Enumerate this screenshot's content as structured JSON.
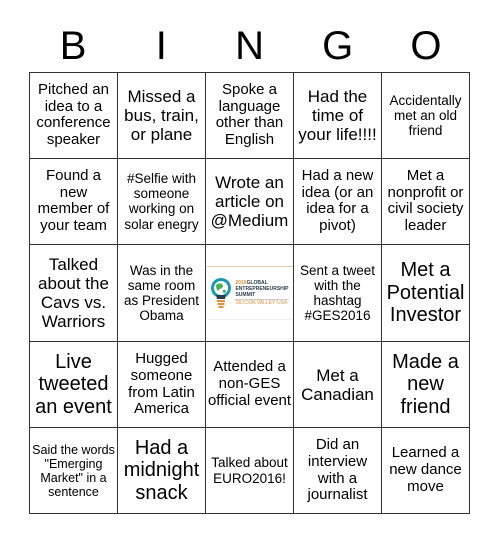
{
  "header": [
    "B",
    "I",
    "N",
    "G",
    "O"
  ],
  "grid": [
    [
      "Pitched an idea to a conference speaker",
      "Missed a bus, train, or plane",
      "Spoke a language other than English",
      "Had the time of your life!!!!",
      "Accidentally met an old friend"
    ],
    [
      "Found a new member of your team",
      "#Selfie with someone working on solar enegry",
      "Wrote an article on @Medium",
      "Had a new idea (or an idea for a pivot)",
      "Met a nonprofit or civil society leader"
    ],
    [
      "Talked about the Cavs vs. Warriors",
      "Was in the same room as President Obama",
      "",
      "Sent a tweet with the hashtag #GES2016",
      "Met a Potential Investor"
    ],
    [
      "Live tweeted an event",
      "Hugged someone from Latin America",
      "Attended a non-GES official event",
      "Met a Canadian",
      "Made a new friend"
    ],
    [
      "Said the words \"Emerging Market\" in a sentence",
      "Had a midnight snack",
      "Talked about EURO2016!",
      "Did an interview with a journalist",
      "Learned a new dance move"
    ]
  ],
  "free_space": {
    "logo_year": "2016",
    "logo_line1": "GLOBAL",
    "logo_line2": "ENTREPRENEURSHIP",
    "logo_line3": "SUMMIT",
    "logo_line4": "SILICON VALLEY·USA",
    "icon": "lightbulb-globe-hand-icon"
  },
  "colors": {
    "grid_line": "#333333",
    "logo_teal": "#1a9ab0",
    "logo_orange": "#e8913a",
    "logo_navy": "#2d3f4e"
  }
}
